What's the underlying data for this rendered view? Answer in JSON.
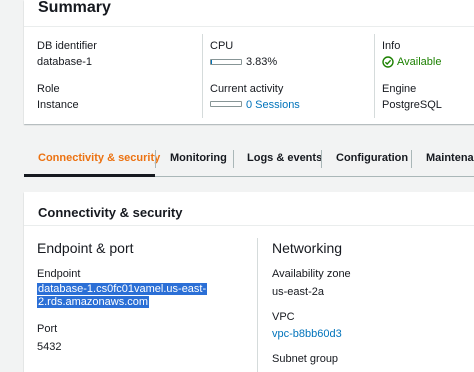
{
  "summary": {
    "title": "Summary",
    "db_identifier": {
      "label": "DB identifier",
      "value": "database-1"
    },
    "cpu": {
      "label": "CPU",
      "value": "3.83%",
      "fraction": 0.0383
    },
    "info": {
      "label": "Info",
      "value": "Available"
    },
    "role": {
      "label": "Role",
      "value": "Instance"
    },
    "current_activity": {
      "label": "Current activity",
      "value": "0 Sessions"
    },
    "engine": {
      "label": "Engine",
      "value": "PostgreSQL"
    }
  },
  "tabs": [
    {
      "label": "Connectivity & security",
      "active": true
    },
    {
      "label": "Monitoring",
      "active": false
    },
    {
      "label": "Logs & events",
      "active": false
    },
    {
      "label": "Configuration",
      "active": false
    },
    {
      "label": "Maintenanc",
      "active": false
    }
  ],
  "connectivity": {
    "title": "Connectivity & security",
    "endpoint_port": {
      "title": "Endpoint & port",
      "endpoint_label": "Endpoint",
      "endpoint_line1": "database-1.cs0fc01vamel.us-east-",
      "endpoint_line2": "2.rds.amazonaws.com",
      "port_label": "Port",
      "port_value": "5432"
    },
    "networking": {
      "title": "Networking",
      "az_label": "Availability zone",
      "az_value": "us-east-2a",
      "vpc_label": "VPC",
      "vpc_value": "vpc-b8bb60d3",
      "subnet_label": "Subnet group"
    }
  },
  "colors": {
    "active_tab": "#ec7211",
    "link": "#0073bb",
    "status_ok": "#1d8102",
    "selection": "#2b6fd6"
  }
}
